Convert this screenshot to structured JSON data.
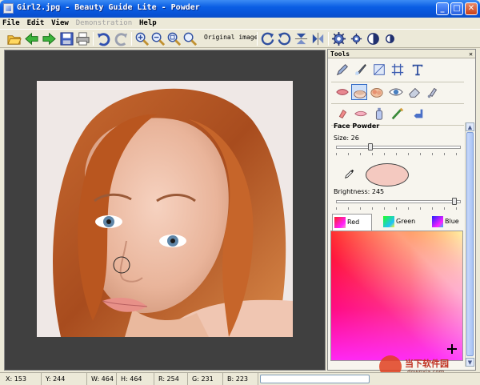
{
  "window": {
    "title": "Girl2.jpg - Beauty Guide Lite - Powder",
    "minimize": "_",
    "maximize": "□",
    "close": "✕"
  },
  "menu": {
    "items": [
      "File",
      "Edit",
      "View",
      "Demonstration",
      "Help"
    ]
  },
  "toolbar": {
    "icons": [
      "open-icon",
      "back-icon",
      "forward-icon",
      "save-icon",
      "print-icon",
      "undo-icon",
      "redo-icon",
      "zoom-in-icon",
      "zoom-out-icon",
      "zoom-fit-icon",
      "zoom-actual-icon",
      "rotate-left-icon",
      "rotate-right-icon",
      "flip-vertical-icon",
      "flip-horizontal-icon",
      "settings-icon",
      "small-settings-icon",
      "contrast-icon",
      "half-contrast-icon"
    ],
    "original_image_label": "Original image"
  },
  "tools_panel": {
    "header": "Tools",
    "close": "✕",
    "tool_rows": [
      [
        "pencil-icon",
        "brush-icon",
        "crop-icon",
        "grid-icon",
        "text-icon"
      ],
      [
        "lips-icon",
        "powder-icon",
        "blush-icon",
        "eye-icon",
        "eraser-icon",
        "bottle-icon"
      ],
      [
        "lipstick-icon",
        "lip-gloss-icon",
        "foundation-icon",
        "mascara-icon",
        "arrow-back-icon"
      ]
    ],
    "active_tool": "powder-icon",
    "section_title": "Face Powder",
    "size_label": "Size: 26",
    "size_value": 26,
    "brightness_label": "Brightness: 245",
    "brightness_value": 245,
    "swatch_color": "#f4c9c0",
    "tabs": [
      {
        "label": "Red"
      },
      {
        "label": "Green"
      },
      {
        "label": "Blue"
      }
    ],
    "active_tab": "Red"
  },
  "status": {
    "x": "X: 153",
    "y": "Y: 244",
    "w": "W: 464",
    "h": "H: 464",
    "r": "R: 254",
    "g": "G: 231",
    "b": "B: 223"
  },
  "watermark": {
    "text_cn": "当下软件园",
    "url": "downxia.com"
  }
}
